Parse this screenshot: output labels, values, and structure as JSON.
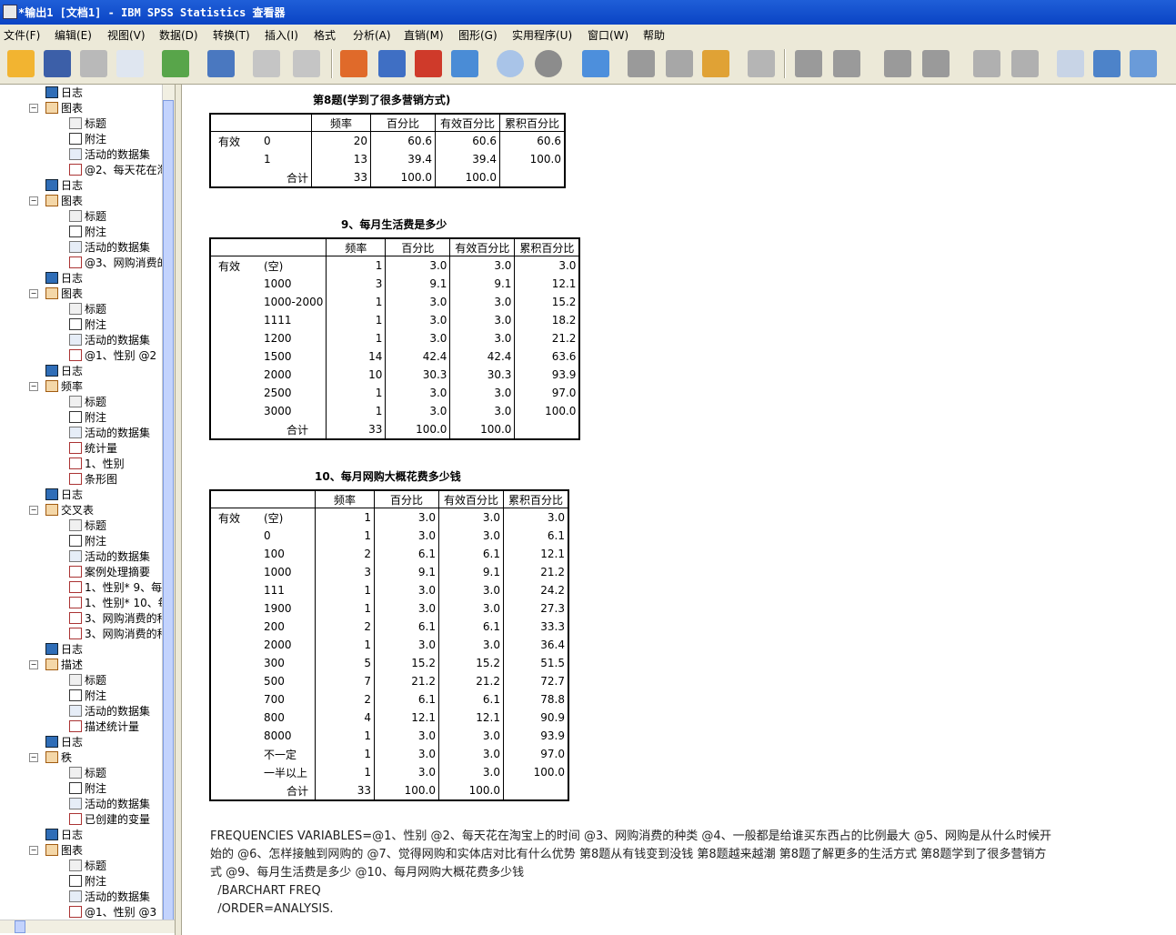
{
  "window": {
    "title": "*输出1 [文档1] - IBM SPSS Statistics 查看器"
  },
  "menu": [
    "文件(F)",
    "编辑(E)",
    "视图(V)",
    "数据(D)",
    "转换(T)",
    "插入(I)",
    "格式",
    "分析(A)",
    "直销(M)",
    "图形(G)",
    "实用程序(U)",
    "窗口(W)",
    "帮助"
  ],
  "tree": [
    {
      "label": "日志",
      "icon": "log"
    },
    {
      "label": "图表",
      "icon": "group"
    },
    {
      "label": "标题",
      "icon": "title"
    },
    {
      "label": "附注",
      "icon": "note"
    },
    {
      "label": "活动的数据集",
      "icon": "dataset"
    },
    {
      "label": "@2、每天花在淘",
      "icon": "chart"
    },
    {
      "label": "日志",
      "icon": "log"
    },
    {
      "label": "图表",
      "icon": "group"
    },
    {
      "label": "标题",
      "icon": "title"
    },
    {
      "label": "附注",
      "icon": "note"
    },
    {
      "label": "活动的数据集",
      "icon": "dataset"
    },
    {
      "label": "@3、网购消费的",
      "icon": "chart"
    },
    {
      "label": "日志",
      "icon": "log"
    },
    {
      "label": "图表",
      "icon": "group"
    },
    {
      "label": "标题",
      "icon": "title"
    },
    {
      "label": "附注",
      "icon": "note"
    },
    {
      "label": "活动的数据集",
      "icon": "dataset"
    },
    {
      "label": "@1、性别 @2",
      "icon": "chart"
    },
    {
      "label": "日志",
      "icon": "log"
    },
    {
      "label": "频率",
      "icon": "group"
    },
    {
      "label": "标题",
      "icon": "title"
    },
    {
      "label": "附注",
      "icon": "note"
    },
    {
      "label": "活动的数据集",
      "icon": "dataset"
    },
    {
      "label": "统计量",
      "icon": "table"
    },
    {
      "label": "1、性别",
      "icon": "table"
    },
    {
      "label": "条形图",
      "icon": "chart"
    },
    {
      "label": "日志",
      "icon": "log"
    },
    {
      "label": "交叉表",
      "icon": "group"
    },
    {
      "label": "标题",
      "icon": "title"
    },
    {
      "label": "附注",
      "icon": "note"
    },
    {
      "label": "活动的数据集",
      "icon": "dataset"
    },
    {
      "label": "案例处理摘要",
      "icon": "table"
    },
    {
      "label": "1、性别* 9、每",
      "icon": "table"
    },
    {
      "label": "1、性别* 10、每",
      "icon": "table"
    },
    {
      "label": "3、网购消费的种",
      "icon": "table"
    },
    {
      "label": "3、网购消费的种",
      "icon": "table"
    },
    {
      "label": "日志",
      "icon": "log"
    },
    {
      "label": "描述",
      "icon": "group"
    },
    {
      "label": "标题",
      "icon": "title"
    },
    {
      "label": "附注",
      "icon": "note"
    },
    {
      "label": "活动的数据集",
      "icon": "dataset"
    },
    {
      "label": "描述统计量",
      "icon": "table"
    },
    {
      "label": "日志",
      "icon": "log"
    },
    {
      "label": "秩",
      "icon": "group"
    },
    {
      "label": "标题",
      "icon": "title"
    },
    {
      "label": "附注",
      "icon": "note"
    },
    {
      "label": "活动的数据集",
      "icon": "dataset"
    },
    {
      "label": "已创建的变量",
      "icon": "table"
    },
    {
      "label": "日志",
      "icon": "log"
    },
    {
      "label": "图表",
      "icon": "group"
    },
    {
      "label": "标题",
      "icon": "title"
    },
    {
      "label": "附注",
      "icon": "note"
    },
    {
      "label": "活动的数据集",
      "icon": "dataset"
    },
    {
      "label": "@1、性别 @3",
      "icon": "chart"
    }
  ],
  "tables": [
    {
      "caption": "第8题(学到了很多营销方式)",
      "headers": [
        "频率",
        "百分比",
        "有效百分比",
        "累积百分比"
      ],
      "group_label": "有效",
      "rows": [
        [
          "0",
          "20",
          "60.6",
          "60.6",
          "60.6"
        ],
        [
          "1",
          "13",
          "39.4",
          "39.4",
          "100.0"
        ],
        [
          "合计",
          "33",
          "100.0",
          "100.0",
          ""
        ]
      ]
    },
    {
      "caption": "9、每月生活费是多少",
      "headers": [
        "频率",
        "百分比",
        "有效百分比",
        "累积百分比"
      ],
      "group_label": "有效",
      "rows": [
        [
          "(空)",
          "1",
          "3.0",
          "3.0",
          "3.0"
        ],
        [
          "1000",
          "3",
          "9.1",
          "9.1",
          "12.1"
        ],
        [
          "1000-2000",
          "1",
          "3.0",
          "3.0",
          "15.2"
        ],
        [
          "1111",
          "1",
          "3.0",
          "3.0",
          "18.2"
        ],
        [
          "1200",
          "1",
          "3.0",
          "3.0",
          "21.2"
        ],
        [
          "1500",
          "14",
          "42.4",
          "42.4",
          "63.6"
        ],
        [
          "2000",
          "10",
          "30.3",
          "30.3",
          "93.9"
        ],
        [
          "2500",
          "1",
          "3.0",
          "3.0",
          "97.0"
        ],
        [
          "3000",
          "1",
          "3.0",
          "3.0",
          "100.0"
        ],
        [
          "合计",
          "33",
          "100.0",
          "100.0",
          ""
        ]
      ]
    },
    {
      "caption": "10、每月网购大概花费多少钱",
      "headers": [
        "频率",
        "百分比",
        "有效百分比",
        "累积百分比"
      ],
      "group_label": "有效",
      "rows": [
        [
          "(空)",
          "1",
          "3.0",
          "3.0",
          "3.0"
        ],
        [
          "0",
          "1",
          "3.0",
          "3.0",
          "6.1"
        ],
        [
          "100",
          "2",
          "6.1",
          "6.1",
          "12.1"
        ],
        [
          "1000",
          "3",
          "9.1",
          "9.1",
          "21.2"
        ],
        [
          "111",
          "1",
          "3.0",
          "3.0",
          "24.2"
        ],
        [
          "1900",
          "1",
          "3.0",
          "3.0",
          "27.3"
        ],
        [
          "200",
          "2",
          "6.1",
          "6.1",
          "33.3"
        ],
        [
          "2000",
          "1",
          "3.0",
          "3.0",
          "36.4"
        ],
        [
          "300",
          "5",
          "15.2",
          "15.2",
          "51.5"
        ],
        [
          "500",
          "7",
          "21.2",
          "21.2",
          "72.7"
        ],
        [
          "700",
          "2",
          "6.1",
          "6.1",
          "78.8"
        ],
        [
          "800",
          "4",
          "12.1",
          "12.1",
          "90.9"
        ],
        [
          "8000",
          "1",
          "3.0",
          "3.0",
          "93.9"
        ],
        [
          "不一定",
          "1",
          "3.0",
          "3.0",
          "97.0"
        ],
        [
          "一半以上",
          "1",
          "3.0",
          "3.0",
          "100.0"
        ],
        [
          "合计",
          "33",
          "100.0",
          "100.0",
          ""
        ]
      ]
    }
  ],
  "syntax": [
    "FREQUENCIES VARIABLES=@1、性别 @2、每天花在淘宝上的时间 @3、网购消费的种类 @4、一般都是给谁买东西占的比例最大 @5、网购是从什么时候开",
    "始的 @6、怎样接触到网购的 @7、觉得网购和实体店对比有什么优势 第8题从有钱变到没钱 第8题越来越潮 第8题了解更多的生活方式 第8题学到了很多营销方",
    "式 @9、每月生活费是多少 @10、每月网购大概花费多少钱",
    "  /BARCHART FREQ",
    "  /ORDER=ANALYSIS."
  ],
  "colors": {
    "titlebar": "#0a43c4",
    "chrome": "#ece9d8",
    "scroll_thumb": "#c3d3fd"
  }
}
